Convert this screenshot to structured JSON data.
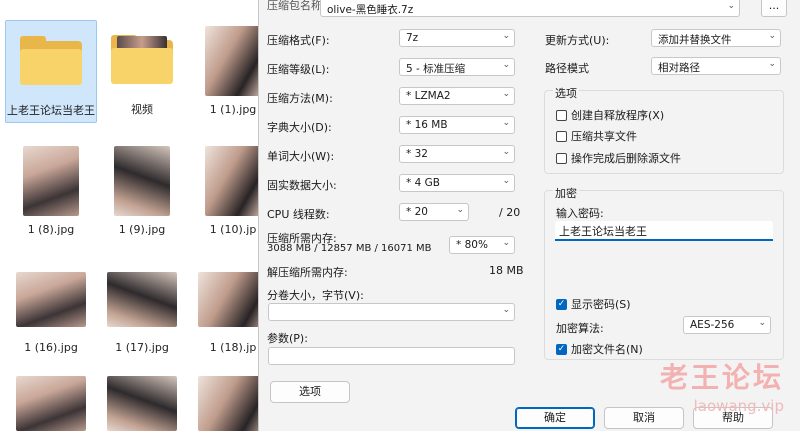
{
  "explorer": {
    "items": [
      {
        "name": "上老王论坛当老王",
        "kind": "folder"
      },
      {
        "name": "视频",
        "kind": "folder"
      },
      {
        "name": "1 (1).jpg",
        "kind": "photo"
      },
      {
        "name": "1 (8).jpg",
        "kind": "photo"
      },
      {
        "name": "1 (9).jpg",
        "kind": "photo"
      },
      {
        "name": "1 (10).jp",
        "kind": "photo"
      },
      {
        "name": "1 (16).jpg",
        "kind": "photo"
      },
      {
        "name": "1 (17).jpg",
        "kind": "photo"
      },
      {
        "name": "1 (18).jp",
        "kind": "photo"
      },
      {
        "name": "",
        "kind": "photo"
      },
      {
        "name": "",
        "kind": "photo"
      },
      {
        "name": "",
        "kind": "photo"
      }
    ]
  },
  "dialog": {
    "archive_label": "压缩包名称(A):",
    "archive_name": "olive-黑色睡衣.7z",
    "browse_label": "...",
    "format_label": "压缩格式(F):",
    "format_value": "7z",
    "level_label": "压缩等级(L):",
    "level_value": "5 - 标准压缩",
    "method_label": "压缩方法(M):",
    "method_value": "* LZMA2",
    "dict_label": "字典大小(D):",
    "dict_value": "* 16 MB",
    "word_label": "单词大小(W):",
    "word_value": "* 32",
    "solid_label": "固实数据大小:",
    "solid_value": "* 4 GB",
    "cpu_label": "CPU 线程数:",
    "cpu_value": "* 20",
    "cpu_total": "/ 20",
    "mem_label": "压缩所需内存:",
    "mem_detail": "3088 MB / 12857 MB / 16071 MB",
    "mem_value": "* 80%",
    "decomp_label": "解压缩所需内存:",
    "decomp_value": "18 MB",
    "split_label": "分卷大小，字节(V):",
    "split_value": "",
    "params_label": "参数(P):",
    "params_value": "",
    "options_button": "选项",
    "update_label": "更新方式(U):",
    "update_value": "添加并替换文件",
    "path_label": "路径模式",
    "path_value": "相对路径",
    "options_group": "选项",
    "opt_sfx": "创建自释放程序(X)",
    "opt_shared": "压缩共享文件",
    "opt_delete": "操作完成后删除源文件",
    "encrypt_group": "加密",
    "password_label": "输入密码:",
    "password_value": "上老王论坛当老王",
    "show_password": "显示密码(S)",
    "enc_method_label": "加密算法:",
    "enc_method_value": "AES-256",
    "enc_names": "加密文件名(N)",
    "ok": "确定",
    "cancel": "取消",
    "help": "帮助"
  },
  "watermark": {
    "big": "老王论坛",
    "small": "laowang.vip"
  },
  "colors": {
    "accent": "#0067c0",
    "folder": "#f8d36a",
    "selection": "#cfe6fb",
    "watermark": "#f3b1b1"
  }
}
